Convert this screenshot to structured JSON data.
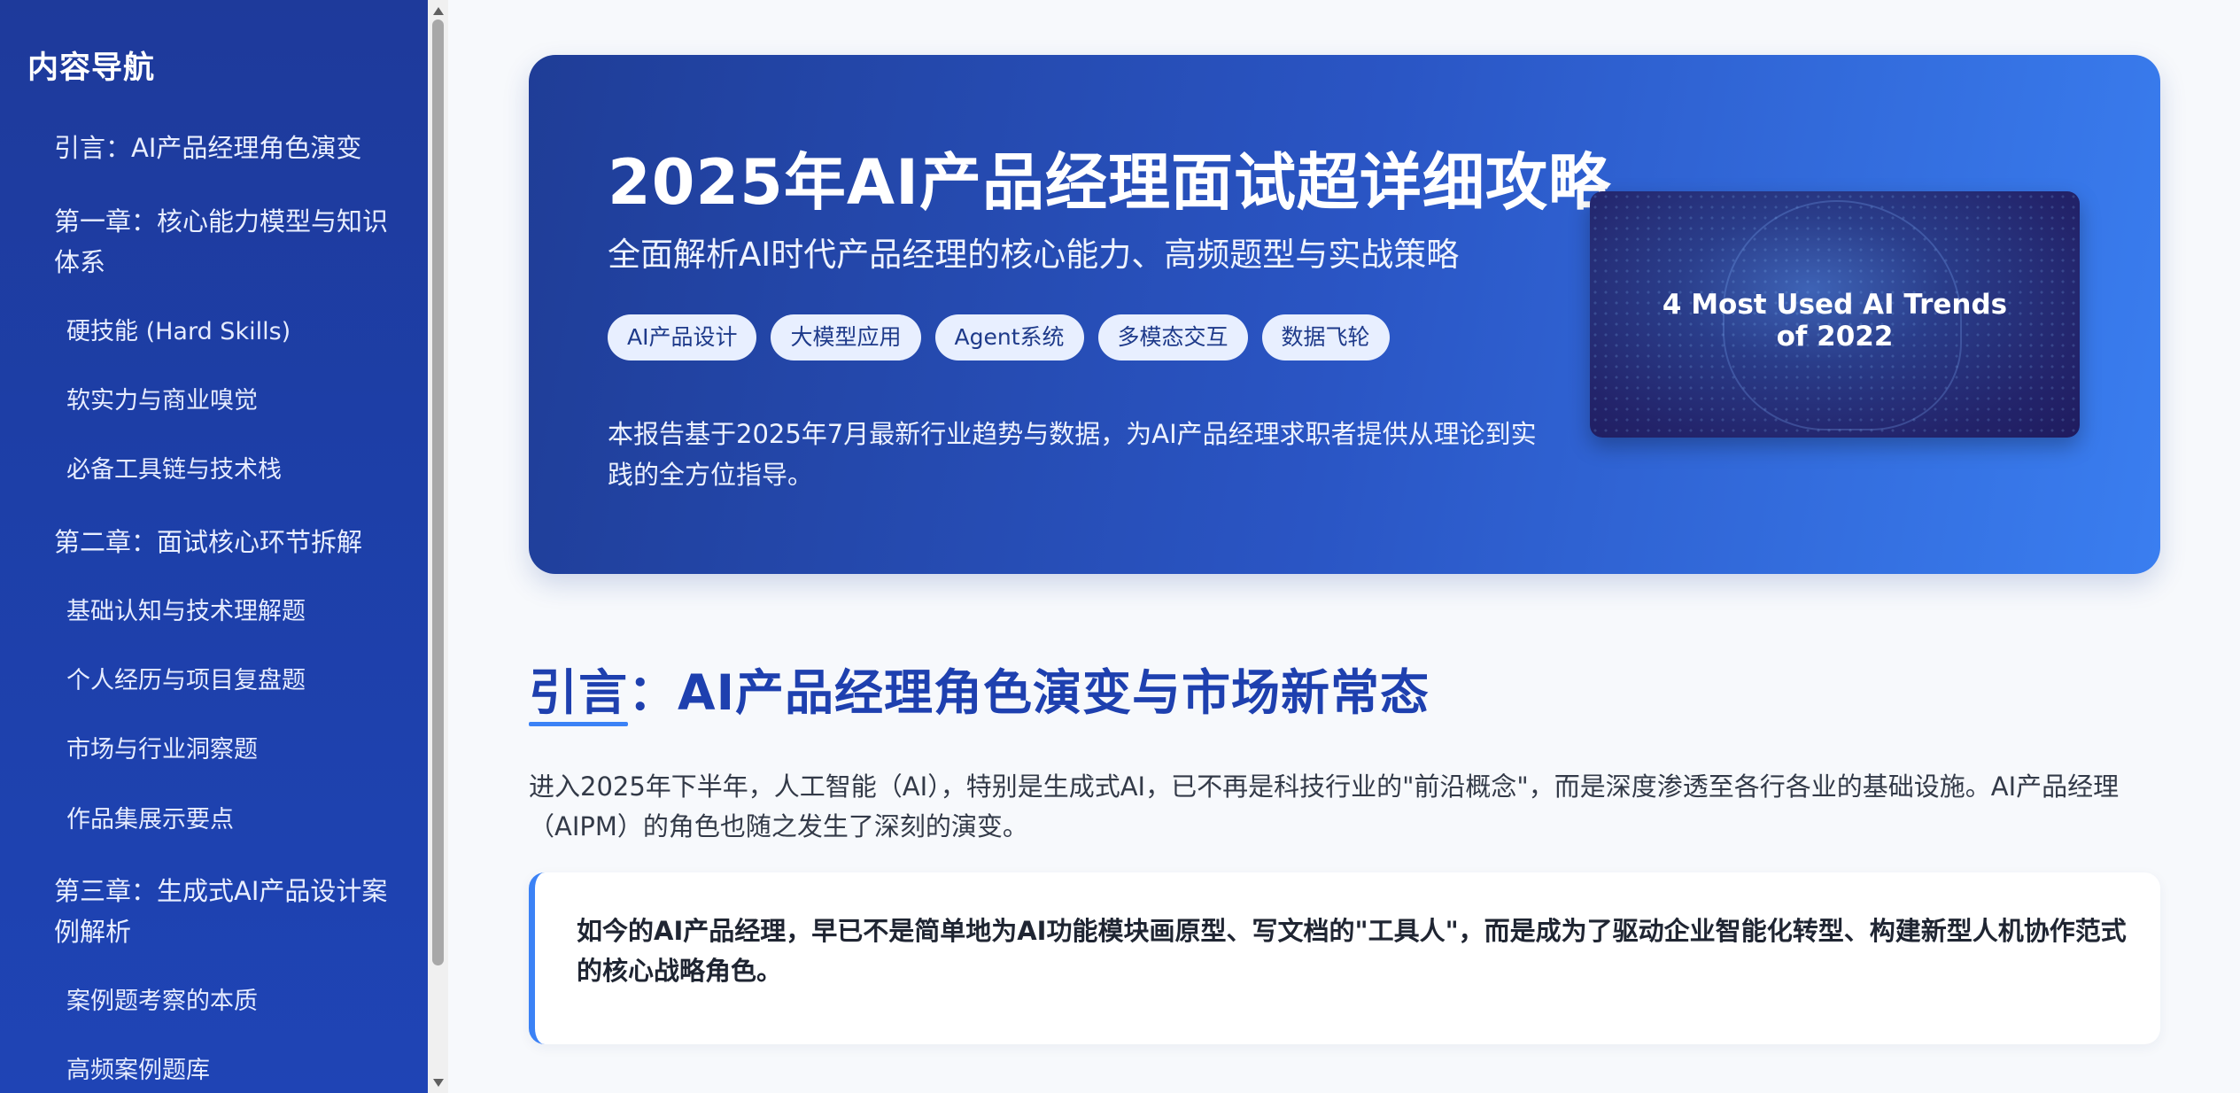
{
  "sidebar": {
    "title": "内容导航",
    "items": [
      {
        "label": "引言：AI产品经理角色演变",
        "level": "chapter"
      },
      {
        "label": "第一章：核心能力模型与知识体系",
        "level": "chapter"
      },
      {
        "label": "硬技能 (Hard Skills)",
        "level": "sub"
      },
      {
        "label": "软实力与商业嗅觉",
        "level": "sub"
      },
      {
        "label": "必备工具链与技术栈",
        "level": "sub"
      },
      {
        "label": "第二章：面试核心环节拆解",
        "level": "chapter"
      },
      {
        "label": "基础认知与技术理解题",
        "level": "sub"
      },
      {
        "label": "个人经历与项目复盘题",
        "level": "sub"
      },
      {
        "label": "市场与行业洞察题",
        "level": "sub"
      },
      {
        "label": "作品集展示要点",
        "level": "sub"
      },
      {
        "label": "第三章：生成式AI产品设计案例解析",
        "level": "chapter"
      },
      {
        "label": "案例题考察的本质",
        "level": "sub"
      },
      {
        "label": "高频案例题库",
        "level": "sub"
      }
    ]
  },
  "hero": {
    "title": "2025年AI产品经理面试超详细攻略",
    "subtitle": "全面解析AI时代产品经理的核心能力、高频题型与实战策略",
    "tags": [
      "AI产品设计",
      "大模型应用",
      "Agent系统",
      "多模态交互",
      "数据飞轮"
    ],
    "description": "本报告基于2025年7月最新行业趋势与数据，为AI产品经理求职者提供从理论到实践的全方位指导。",
    "image_caption": "4 Most Used AI Trends\nof 2022"
  },
  "intro": {
    "title": "引言：AI产品经理角色演变与市场新常态",
    "paragraph": "进入2025年下半年，人工智能（AI），特别是生成式AI，已不再是科技行业的\"前沿概念\"，而是深度渗透至各行各业的基础设施。AI产品经理（AIPM）的角色也随之发生了深刻的演变。",
    "quote": "如今的AI产品经理，早已不是简单地为AI功能模块画原型、写文档的\"工具人\"，而是成为了驱动企业智能化转型、构建新型人机协作范式的核心战略角色。"
  },
  "colors": {
    "sidebar_bg": "#1e3a9b",
    "accent": "#3b82f6",
    "heading": "#1e40af"
  }
}
